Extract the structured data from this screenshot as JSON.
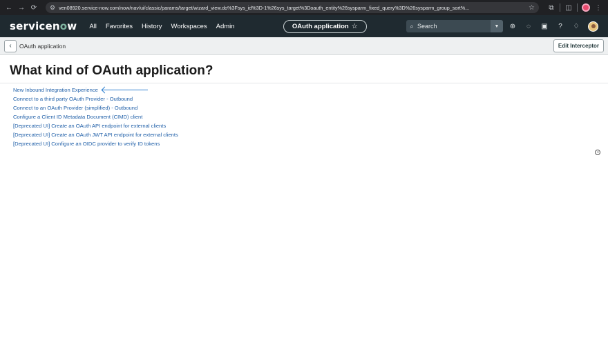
{
  "browser": {
    "url": "ven08920.service-now.com/now/nav/ui/classic/params/target/wizard_view.do%3Fsys_id%3D-1%26sys_target%3Doauth_entity%26sysparm_fixed_query%3D%26sysparm_group_sort%..."
  },
  "header": {
    "logo": "servicenow",
    "menu": [
      "All",
      "Favorites",
      "History",
      "Workspaces",
      "Admin"
    ],
    "context_label": "OAuth application",
    "search_label": "Search"
  },
  "subheader": {
    "breadcrumb": "OAuth application",
    "edit_button": "Edit Interceptor"
  },
  "main": {
    "title": "What kind of OAuth application?",
    "links": [
      "New Inbound Integration Experience",
      "Connect to a third party OAuth Provider - Outbound",
      "Connect to an OAuth Provider (simplified) - Outbound",
      "Configure a Client ID Metadata Document (CIMD) client",
      "[Deprecated UI] Create an OAuth API endpoint for external clients",
      "[Deprecated UI] Create an OAuth JWT API endpoint for external clients",
      "[Deprecated UI] Configure an OIDC provider to verify ID tokens"
    ]
  },
  "colors": {
    "header_bg": "#1f2a30",
    "link": "#1f5fa8",
    "arrow": "#2f80d0"
  }
}
